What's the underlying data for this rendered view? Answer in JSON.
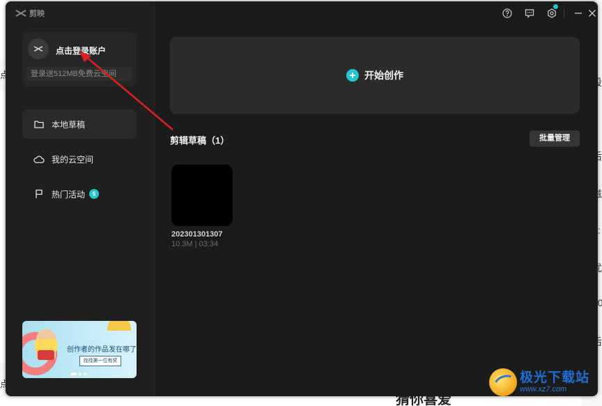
{
  "background": {
    "right_edge_fragments": [
      "段",
      "9",
      "后",
      "滋",
      "2:",
      "优",
      "20",
      "后"
    ],
    "left_fragment_top": "点",
    "left_fragment_bottom": "点",
    "bottom_heading": "猜你喜爱"
  },
  "app": {
    "logo_text": "剪映",
    "login": {
      "label": "点击登录账户",
      "subtitle": "登录送512MB免费云空间"
    },
    "nav": [
      {
        "label": "本地草稿",
        "icon": "folder-icon",
        "active": true
      },
      {
        "label": "我的云空间",
        "icon": "cloud-icon",
        "active": false
      },
      {
        "label": "热门活动",
        "icon": "flag-icon",
        "active": false,
        "badge": "6"
      }
    ],
    "banner": {
      "title": "创作者的作品发在哪了?",
      "button": "找找第一位有奖"
    },
    "topbar": {
      "icons": [
        "help-icon",
        "feedback-icon",
        "settings-icon",
        "minimize-icon",
        "close-icon"
      ]
    },
    "start": {
      "label": "开始创作"
    },
    "drafts": {
      "title": "剪辑草稿（1）",
      "batch_button": "批量管理",
      "items": [
        {
          "name": "202301301307",
          "meta": "10.3M | 03:34"
        }
      ]
    }
  },
  "watermark": {
    "main": "极光下载站",
    "url": "www.xz7.com"
  },
  "colors": {
    "accent": "#20c7d1",
    "window_bg": "#1b1b1c",
    "sidebar_bg": "#1f1f20",
    "annotation_arrow": "#e02020"
  }
}
